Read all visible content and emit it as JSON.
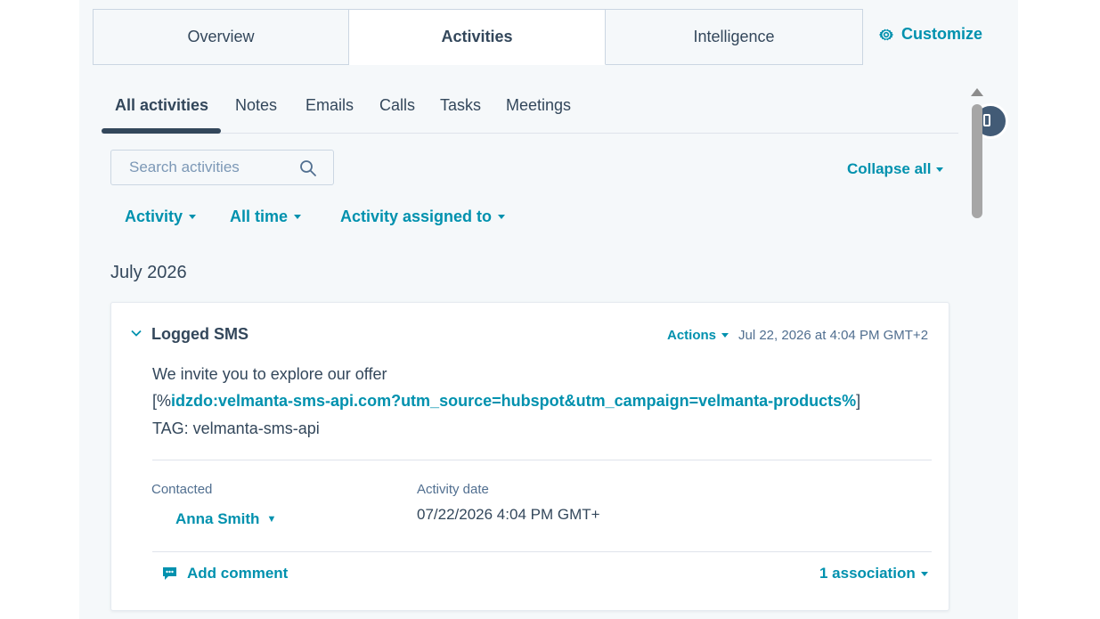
{
  "top_tabs": [
    {
      "label": "Overview"
    },
    {
      "label": "Activities"
    },
    {
      "label": "Intelligence"
    }
  ],
  "customize_label": "Customize",
  "sub_tabs": [
    {
      "label": "All activities"
    },
    {
      "label": "Notes"
    },
    {
      "label": "Emails"
    },
    {
      "label": "Calls"
    },
    {
      "label": "Tasks"
    },
    {
      "label": "Meetings"
    }
  ],
  "search": {
    "placeholder": "Search activities"
  },
  "collapse_all_label": "Collapse all",
  "filters": [
    {
      "label": "Activity"
    },
    {
      "label": "All time"
    },
    {
      "label": "Activity assigned to"
    }
  ],
  "month_heading": "July 2026",
  "activity": {
    "title": "Logged SMS",
    "actions_label": "Actions",
    "timestamp": "Jul 22, 2026 at 4:04 PM GMT+2",
    "body_line1": "We invite you to explore our offer",
    "link_open": "[%",
    "link_text": "idzdo:velmanta-sms-api.com?utm_source=hubspot&utm_campaign=velmanta-products%",
    "link_close": "]",
    "body_tag": "TAG: velmanta-sms-api",
    "contacted_label": "Contacted",
    "contacted_value": "Anna Smith",
    "activity_date_label": "Activity date",
    "activity_date_value": "07/22/2026 4:04 PM GMT+",
    "add_comment_label": "Add comment",
    "association_label": "1 association"
  },
  "colors": {
    "accent": "#0091ae",
    "text": "#33475b",
    "panel_bg": "#f5f8fa",
    "border": "#cbd6e2"
  }
}
